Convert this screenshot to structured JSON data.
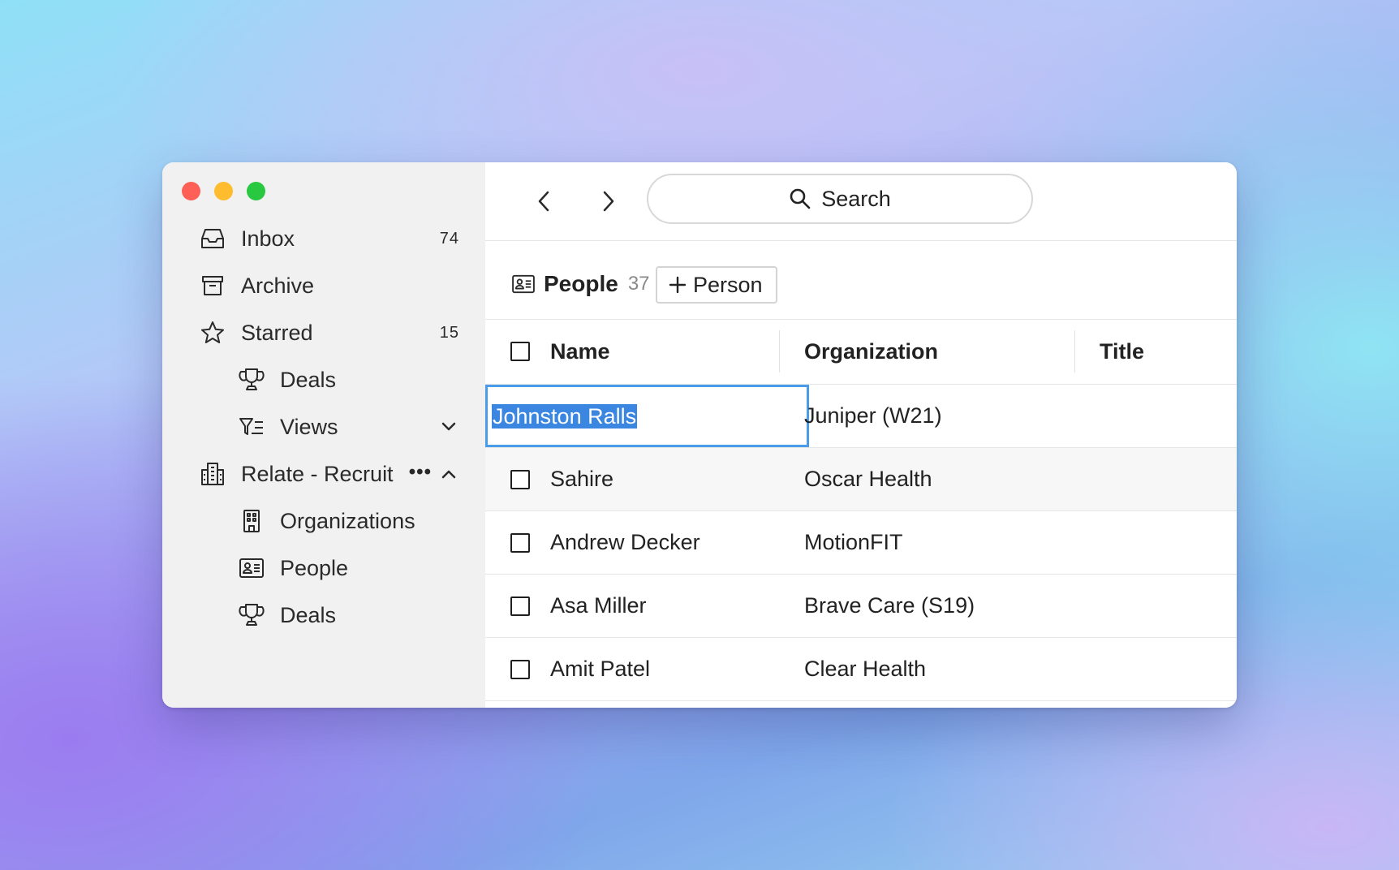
{
  "window": {
    "traffic_lights": [
      "close",
      "minimize",
      "zoom"
    ]
  },
  "sidebar": {
    "items": [
      {
        "label": "Inbox",
        "count": "74",
        "icon": "inbox-icon"
      },
      {
        "label": "Archive",
        "icon": "archive-icon"
      },
      {
        "label": "Starred",
        "count": "15",
        "icon": "star-icon"
      },
      {
        "label": "Deals",
        "icon": "trophy-icon"
      },
      {
        "label": "Views",
        "icon": "filter-list-icon"
      },
      {
        "label": "Relate - Recruit",
        "more": "•••",
        "icon": "building-icon"
      },
      {
        "label": "Organizations",
        "icon": "office-building-icon"
      },
      {
        "label": "People",
        "icon": "contact-card-icon"
      },
      {
        "label": "Deals",
        "icon": "trophy-icon"
      }
    ]
  },
  "toolbar": {
    "search_label": "Search"
  },
  "people_header": {
    "title": "People",
    "count": "37",
    "add_button": "Person"
  },
  "table": {
    "columns": [
      "Name",
      "Organization",
      "Title"
    ],
    "rows": [
      {
        "name": "Johnston Ralls",
        "organization": "Juniper (W21)",
        "title": "",
        "editing": true
      },
      {
        "name": "Sahire",
        "organization": "Oscar Health",
        "title": ""
      },
      {
        "name": "Andrew Decker",
        "organization": "MotionFIT",
        "title": ""
      },
      {
        "name": "Asa Miller",
        "organization": "Brave Care (S19)",
        "title": ""
      },
      {
        "name": "Amit Patel",
        "organization": "Clear Health",
        "title": ""
      }
    ]
  },
  "colors": {
    "selection": "#3a86e0",
    "edit_border": "#4a9be8",
    "sidebar_bg": "#f1f1f1"
  }
}
